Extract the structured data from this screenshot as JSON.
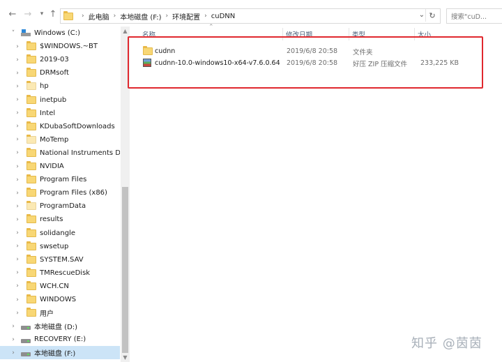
{
  "address": {
    "crumbs": [
      "此电脑",
      "本地磁盘 (F:)",
      "环境配置",
      "cuDNN"
    ]
  },
  "search": {
    "placeholder": "搜索\"cuD..."
  },
  "sidebar": {
    "items": [
      {
        "label": "Windows (C:)",
        "icon": "windows-drive-icon",
        "expanded": true
      },
      {
        "label": "$WINDOWS.~BT",
        "icon": "folder-icon"
      },
      {
        "label": "2019-03",
        "icon": "folder-icon"
      },
      {
        "label": "DRMsoft",
        "icon": "folder-icon"
      },
      {
        "label": "hp",
        "icon": "folder-icon"
      },
      {
        "label": "inetpub",
        "icon": "folder-icon"
      },
      {
        "label": "Intel",
        "icon": "folder-icon"
      },
      {
        "label": "KDubaSoftDownloads",
        "icon": "folder-icon"
      },
      {
        "label": "MoTemp",
        "icon": "folder-icon"
      },
      {
        "label": "National Instruments Dow",
        "icon": "folder-icon"
      },
      {
        "label": "NVIDIA",
        "icon": "folder-icon"
      },
      {
        "label": "Program Files",
        "icon": "folder-icon"
      },
      {
        "label": "Program Files (x86)",
        "icon": "folder-icon"
      },
      {
        "label": "ProgramData",
        "icon": "folder-icon"
      },
      {
        "label": "results",
        "icon": "folder-icon"
      },
      {
        "label": "solidangle",
        "icon": "folder-icon"
      },
      {
        "label": "swsetup",
        "icon": "folder-icon"
      },
      {
        "label": "SYSTEM.SAV",
        "icon": "folder-icon"
      },
      {
        "label": "TMRescueDisk",
        "icon": "folder-icon"
      },
      {
        "label": "WCH.CN",
        "icon": "folder-icon"
      },
      {
        "label": "WINDOWS",
        "icon": "folder-icon"
      },
      {
        "label": "用户",
        "icon": "folder-icon"
      },
      {
        "label": "本地磁盘 (D:)",
        "icon": "drive-icon"
      },
      {
        "label": "RECOVERY (E:)",
        "icon": "drive-icon"
      },
      {
        "label": "本地磁盘 (F:)",
        "icon": "drive-icon",
        "selected": true
      }
    ]
  },
  "columns": {
    "name": "名称",
    "date": "修改日期",
    "type": "类型",
    "size": "大小"
  },
  "files": [
    {
      "name": "cudnn",
      "date": "2019/6/8 20:58",
      "type": "文件夹",
      "size": "",
      "icon": "folder-icon"
    },
    {
      "name": "cudnn-10.0-windows10-x64-v7.6.0.64....",
      "date": "2019/6/8 20:58",
      "type": "好压 ZIP 压缩文件",
      "size": "233,225 KB",
      "icon": "archive-icon"
    }
  ],
  "watermark": "知乎 @茵茵",
  "colors": {
    "highlight": "#e0282e",
    "selected": "#cce4f7"
  }
}
